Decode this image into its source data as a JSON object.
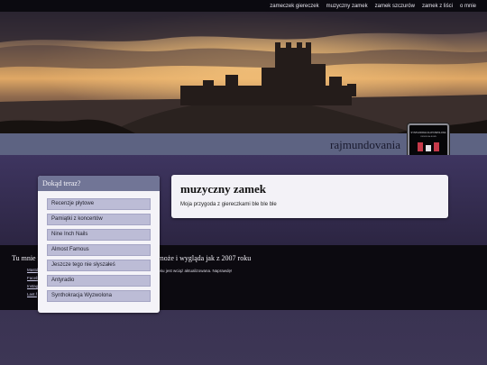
{
  "topnav": {
    "items": [
      {
        "label": "zameczek giereczek"
      },
      {
        "label": "muzyczny zamek"
      },
      {
        "label": "zamek szczurów"
      },
      {
        "label": "zamek z liści"
      },
      {
        "label": "o mnie"
      }
    ]
  },
  "header": {
    "site_title": "rajmundovania",
    "album_text_1": "SYNTHOKRACJA WYZWOLONA",
    "album_text_2": "CIENKIE ALBUMU"
  },
  "sidebar": {
    "title": "Dokąd teraz?",
    "items": [
      {
        "label": "Recenzje płytowe"
      },
      {
        "label": "Pamiątki z koncertów"
      },
      {
        "label": "Nine Inch Nails"
      },
      {
        "label": "Almost Famous"
      },
      {
        "label": "Jeszcze tego nie słyszałeś"
      },
      {
        "label": "Antyradio"
      },
      {
        "label": "Synthokracja Wyzwolona"
      }
    ]
  },
  "content": {
    "title": "muzyczny zamek",
    "text": "Moja przygoda z giereczkami ble ble ble"
  },
  "footer": {
    "title_start": "Tu mnie n",
    "title_end": "a może i wygląda jak z 2007 roku",
    "note": "4 roku jest wciąż aktualizowana. Naprawdę!",
    "links": [
      {
        "label": "Mastd"
      },
      {
        "label": "Faceb"
      },
      {
        "label": "Instag"
      },
      {
        "label": "Last.f"
      }
    ]
  },
  "colors": {
    "band": "#5d6382",
    "widget_header": "#717596",
    "list_item": "#bcbcd6",
    "footer": "#0c0a10"
  }
}
